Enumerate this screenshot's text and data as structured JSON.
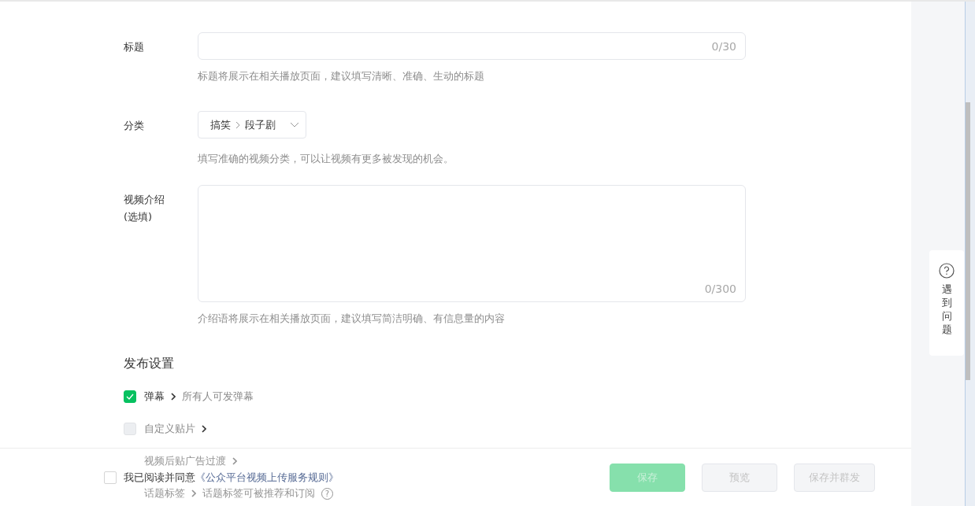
{
  "form": {
    "title": {
      "label": "标题",
      "counter": "0/30",
      "hint": "标题将展示在相关播放页面，建议填写清晰、准确、生动的标题"
    },
    "category": {
      "label": "分类",
      "path": [
        "搞笑",
        "段子剧"
      ],
      "hint": "填写准确的视频分类，可以让视频有更多被发现的机会。"
    },
    "description": {
      "label": [
        "视频介绍",
        "(选填)"
      ],
      "counter": "0/300",
      "hint": "介绍语将展示在相关播放页面，建议填写简洁明确、有信息量的内容"
    }
  },
  "publish_settings": {
    "heading": "发布设置",
    "items": [
      {
        "kind": "checkbox",
        "label": "弹幕",
        "checked": true,
        "detail": "所有人可发弹幕"
      },
      {
        "kind": "checkbox",
        "label": "自定义贴片",
        "checked": false
      },
      {
        "kind": "covered",
        "label": "视频后贴广告过渡"
      },
      {
        "kind": "covered",
        "label": "话题标签",
        "detail": "话题标签可被推荐和订阅",
        "help": "?"
      }
    ]
  },
  "footer": {
    "agree_checked": false,
    "agree_text": "我已阅读并同意",
    "agree_link": "《公众平台视频上传服务规则》",
    "buttons": [
      {
        "label": "保存",
        "kind": "primary",
        "disabled": true
      },
      {
        "label": "预览",
        "kind": "default",
        "disabled": true
      },
      {
        "label": "保存并群发",
        "kind": "default",
        "disabled": true
      }
    ]
  },
  "help_panel": {
    "text": "遇到问题"
  }
}
